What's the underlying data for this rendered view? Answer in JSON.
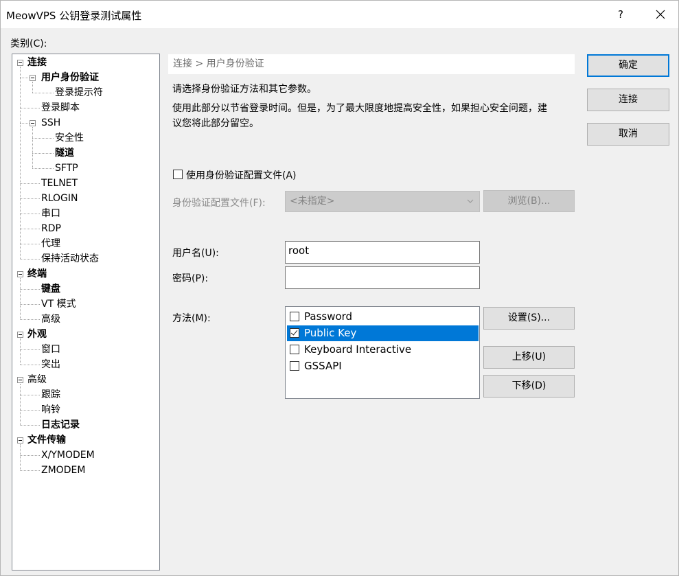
{
  "window": {
    "title": "MeowVPS 公钥登录测试属性",
    "help": "?"
  },
  "category_label": "类别(C):",
  "tree": [
    {
      "label": "连接",
      "bold": true,
      "level": 0,
      "expander": true
    },
    {
      "label": "用户身份验证",
      "bold": true,
      "level": 1,
      "expander": true
    },
    {
      "label": "登录提示符",
      "bold": false,
      "level": 2,
      "expander": false
    },
    {
      "label": "登录脚本",
      "bold": false,
      "level": 1,
      "expander": false
    },
    {
      "label": "SSH",
      "bold": false,
      "level": 1,
      "expander": true
    },
    {
      "label": "安全性",
      "bold": false,
      "level": 2,
      "expander": false
    },
    {
      "label": "隧道",
      "bold": true,
      "level": 2,
      "expander": false
    },
    {
      "label": "SFTP",
      "bold": false,
      "level": 2,
      "expander": false
    },
    {
      "label": "TELNET",
      "bold": false,
      "level": 1,
      "expander": false
    },
    {
      "label": "RLOGIN",
      "bold": false,
      "level": 1,
      "expander": false
    },
    {
      "label": "串口",
      "bold": false,
      "level": 1,
      "expander": false
    },
    {
      "label": "RDP",
      "bold": false,
      "level": 1,
      "expander": false
    },
    {
      "label": "代理",
      "bold": false,
      "level": 1,
      "expander": false
    },
    {
      "label": "保持活动状态",
      "bold": false,
      "level": 1,
      "expander": false
    },
    {
      "label": "终端",
      "bold": true,
      "level": 0,
      "expander": true
    },
    {
      "label": "键盘",
      "bold": true,
      "level": 1,
      "expander": false
    },
    {
      "label": "VT 模式",
      "bold": false,
      "level": 1,
      "expander": false
    },
    {
      "label": "高级",
      "bold": false,
      "level": 1,
      "expander": false
    },
    {
      "label": "外观",
      "bold": true,
      "level": 0,
      "expander": true
    },
    {
      "label": "窗口",
      "bold": false,
      "level": 1,
      "expander": false
    },
    {
      "label": "突出",
      "bold": false,
      "level": 1,
      "expander": false
    },
    {
      "label": "高级",
      "bold": false,
      "level": 0,
      "expander": true
    },
    {
      "label": "跟踪",
      "bold": false,
      "level": 1,
      "expander": false
    },
    {
      "label": "响铃",
      "bold": false,
      "level": 1,
      "expander": false
    },
    {
      "label": "日志记录",
      "bold": true,
      "level": 1,
      "expander": false
    },
    {
      "label": "文件传输",
      "bold": true,
      "level": 0,
      "expander": true
    },
    {
      "label": "X/YMODEM",
      "bold": false,
      "level": 1,
      "expander": false
    },
    {
      "label": "ZMODEM",
      "bold": false,
      "level": 1,
      "expander": false
    }
  ],
  "breadcrumb": "连接 > 用户身份验证",
  "description": {
    "line1": "请选择身份验证方法和其它参数。",
    "line2": "使用此部分以节省登录时间。但是，为了最大限度地提高安全性，如果担心安全问题，建",
    "line3": "议您将此部分留空。"
  },
  "use_profile": {
    "label": "使用身份验证配置文件(A)",
    "checked": false
  },
  "profile": {
    "label": "身份验证配置文件(F):",
    "value": "<未指定>",
    "browse_label": "浏览(B)..."
  },
  "username": {
    "label": "用户名(U):",
    "value": "root"
  },
  "password": {
    "label": "密码(P):",
    "value": ""
  },
  "method": {
    "label": "方法(M):",
    "items": [
      {
        "label": "Password",
        "checked": false,
        "selected": false
      },
      {
        "label": "Public Key",
        "checked": true,
        "selected": true
      },
      {
        "label": "Keyboard Interactive",
        "checked": false,
        "selected": false
      },
      {
        "label": "GSSAPI",
        "checked": false,
        "selected": false
      }
    ],
    "settings_label": "设置(S)...",
    "move_up_label": "上移(U)",
    "move_down_label": "下移(D)"
  },
  "buttons": {
    "ok": "确定",
    "connect": "连接",
    "cancel": "取消"
  },
  "colors": {
    "selection": "#0078d7",
    "default_button_border": "#0078d7",
    "disabled_text": "#838383"
  }
}
